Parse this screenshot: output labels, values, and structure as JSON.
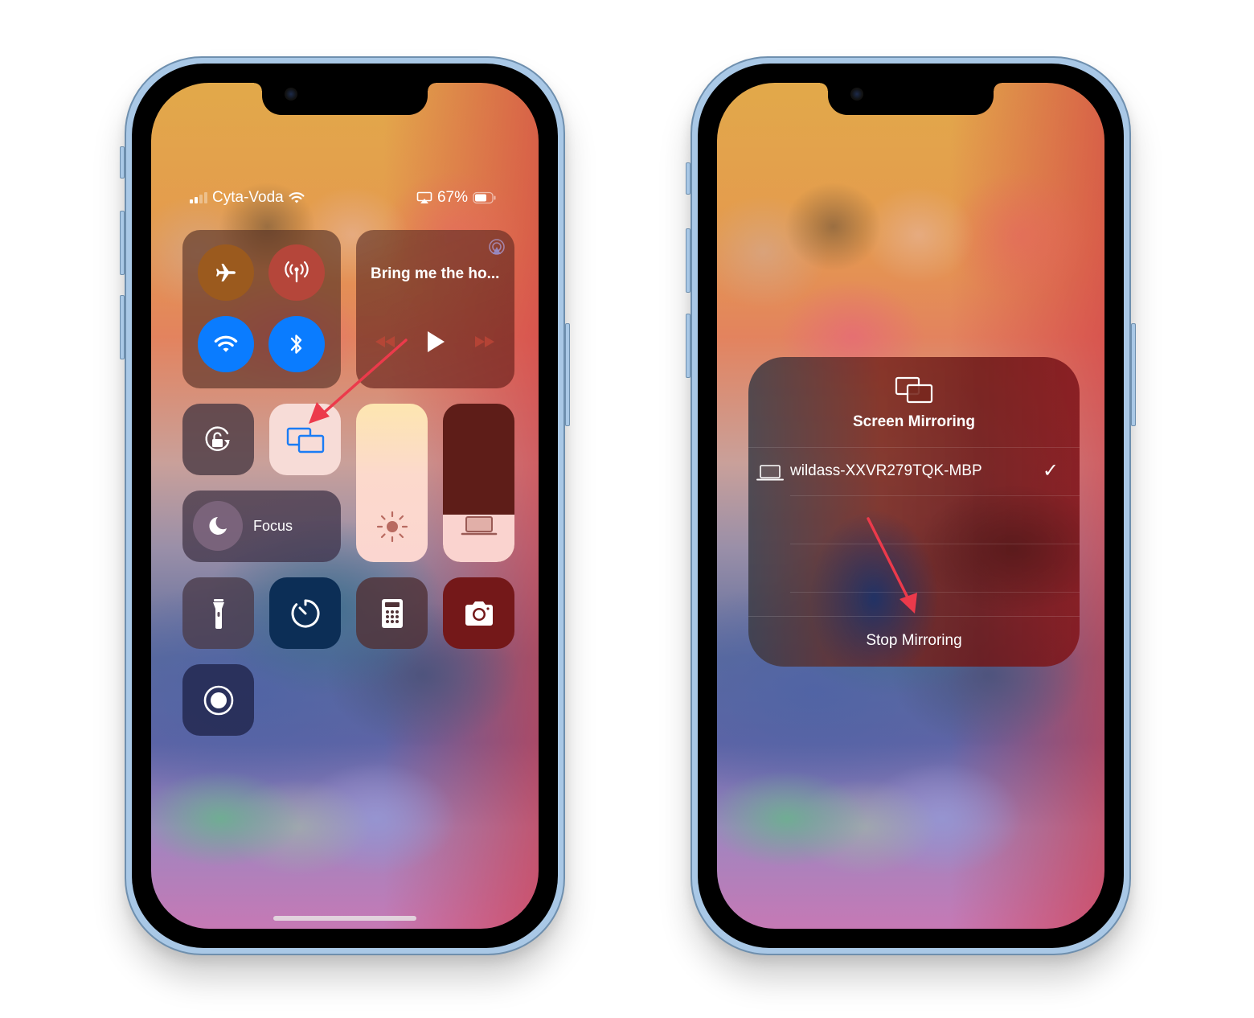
{
  "left_phone": {
    "status_bar": {
      "carrier": "Cyta-Voda",
      "battery_percent": "67%",
      "signal_bars_active": 2,
      "signal_bars_total": 4,
      "icons": [
        "signal-icon",
        "wifi-icon",
        "screen-mirroring-status-icon",
        "battery-icon"
      ]
    },
    "connectivity": {
      "airplane_mode": {
        "icon": "airplane-icon",
        "state": "off",
        "color": "#9b5a1e"
      },
      "cellular_data": {
        "icon": "antenna-icon",
        "state": "off",
        "color": "#b5463a"
      },
      "wifi": {
        "icon": "wifi-icon",
        "state": "on",
        "color": "#0a7cff"
      },
      "bluetooth": {
        "icon": "bluetooth-icon",
        "state": "on",
        "color": "#0a7cff"
      }
    },
    "now_playing": {
      "title": "Bring me the ho...",
      "airplay_icon": "airplay-audio-icon",
      "controls": [
        "rewind-icon",
        "play-icon",
        "fast-forward-icon"
      ]
    },
    "tiles": {
      "orientation_lock": {
        "icon": "orientation-lock-icon"
      },
      "screen_mirroring": {
        "icon": "screen-mirroring-icon",
        "state": "active",
        "accent": "#1a7cf5"
      },
      "brightness": {
        "icon": "sun-icon",
        "level": 0.85
      },
      "volume": {
        "icon": "laptop-output-icon",
        "level": 0.3
      },
      "focus": {
        "label": "Focus",
        "icon": "moon-icon"
      },
      "flashlight": {
        "icon": "flashlight-icon"
      },
      "timer": {
        "icon": "timer-icon"
      },
      "calculator": {
        "icon": "calculator-icon"
      },
      "camera": {
        "icon": "camera-icon"
      },
      "screen_recording": {
        "icon": "record-icon"
      }
    },
    "annotation": {
      "type": "arrow",
      "color": "#ec3a4b",
      "target": "screen-mirroring-tile"
    }
  },
  "right_phone": {
    "screen_mirroring_panel": {
      "title": "Screen Mirroring",
      "icon": "screen-mirroring-icon",
      "devices": [
        {
          "name": "wildass-XXVR279TQK-MBP",
          "icon": "laptop-icon",
          "selected": true
        }
      ],
      "empty_rows": 2,
      "stop_label": "Stop Mirroring"
    },
    "annotation": {
      "type": "arrow",
      "color": "#ec3a4b",
      "target": "stop-mirroring-button"
    }
  }
}
